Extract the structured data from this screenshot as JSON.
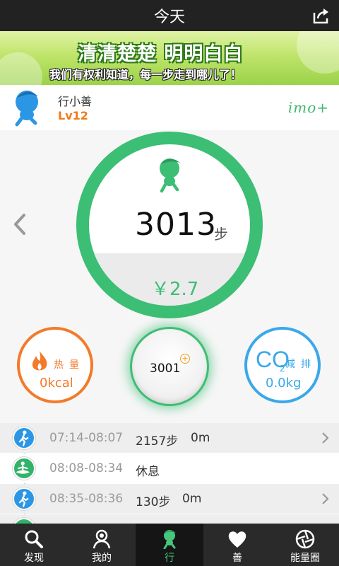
{
  "header": {
    "title": "今天",
    "share_icon": "share-icon"
  },
  "banner": {
    "line1": "清清楚楚 明明白白",
    "line2": "我们有权利知道，每一步走到哪儿了！"
  },
  "profile": {
    "username": "行小善",
    "level": "Lv12",
    "brand": "imo+"
  },
  "summary": {
    "steps": "3013",
    "steps_unit": "步",
    "money": "￥2.7"
  },
  "heat": {
    "label": "热量",
    "value": "0kcal"
  },
  "center": {
    "value": "3001",
    "badge": "+"
  },
  "co2": {
    "main": "CO",
    "sub": "2",
    "label": "减排",
    "value": "0.0kg"
  },
  "timeline": [
    {
      "time": "07:14-08:07",
      "steps": "2157步",
      "distance": "0m",
      "type": "walk"
    },
    {
      "time": "08:08-08:34",
      "steps": "休息",
      "distance": "",
      "type": "rest"
    },
    {
      "time": "08:35-08:36",
      "steps": "130步",
      "distance": "0m",
      "type": "walk"
    }
  ],
  "tabs": [
    {
      "label": "发现",
      "icon": "search-icon"
    },
    {
      "label": "我的",
      "icon": "user-icon"
    },
    {
      "label": "行",
      "icon": "walker-icon"
    },
    {
      "label": "善",
      "icon": "heart-icon"
    },
    {
      "label": "能量圈",
      "icon": "aperture-icon"
    }
  ],
  "colors": {
    "green": "#3cbe74",
    "orange": "#f37a2a",
    "blue": "#3aa8ea",
    "level": "#f07a18"
  }
}
